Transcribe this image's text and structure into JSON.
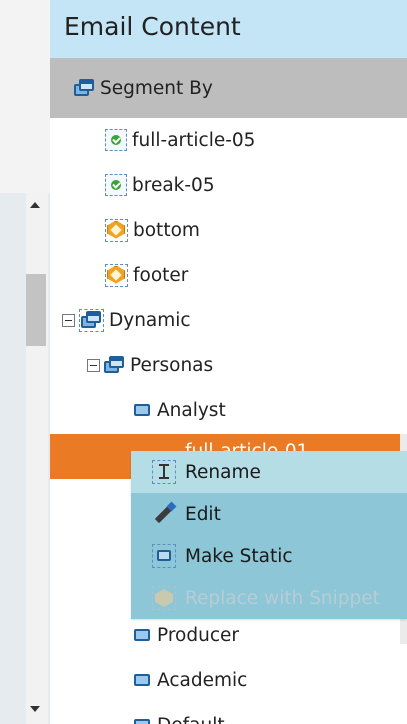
{
  "panel": {
    "title": "Email Content"
  },
  "segment_by": {
    "label": "Segment By",
    "icon": "segment-icon"
  },
  "tree": {
    "items": [
      {
        "label": "full-article-05",
        "icon": "editable-section-icon"
      },
      {
        "label": "break-05",
        "icon": "editable-section-icon"
      },
      {
        "label": "bottom",
        "icon": "snippet-icon"
      },
      {
        "label": "footer",
        "icon": "snippet-icon"
      },
      {
        "label": "Dynamic",
        "icon": "dynamic-module-icon",
        "expanded": true
      },
      {
        "label": "Personas",
        "icon": "module-icon",
        "expanded": true
      },
      {
        "label": "Analyst",
        "icon": "segment-icon"
      },
      {
        "label": "full-article-01",
        "icon": "editable-section-icon",
        "selected": true
      },
      {
        "label": "Producer",
        "icon": "segment-icon"
      },
      {
        "label": "Academic",
        "icon": "segment-icon"
      },
      {
        "label": "Default",
        "icon": "segment-icon"
      }
    ]
  },
  "context_menu": {
    "items": [
      {
        "label": "Rename",
        "icon": "rename-cursor-icon",
        "state": "hover"
      },
      {
        "label": "Edit",
        "icon": "pencil-icon",
        "state": "normal"
      },
      {
        "label": "Make Static",
        "icon": "make-static-icon",
        "state": "normal"
      },
      {
        "label": "Replace with Snippet",
        "icon": "snippet-icon",
        "state": "disabled"
      }
    ]
  },
  "colors": {
    "header_bg": "#c3e5f6",
    "segment_row_bg": "#bdbdbd",
    "selected_row_bg": "#ea7a23",
    "menu_bg": "#8cc6d7",
    "menu_hover_bg": "#b5dde6"
  }
}
